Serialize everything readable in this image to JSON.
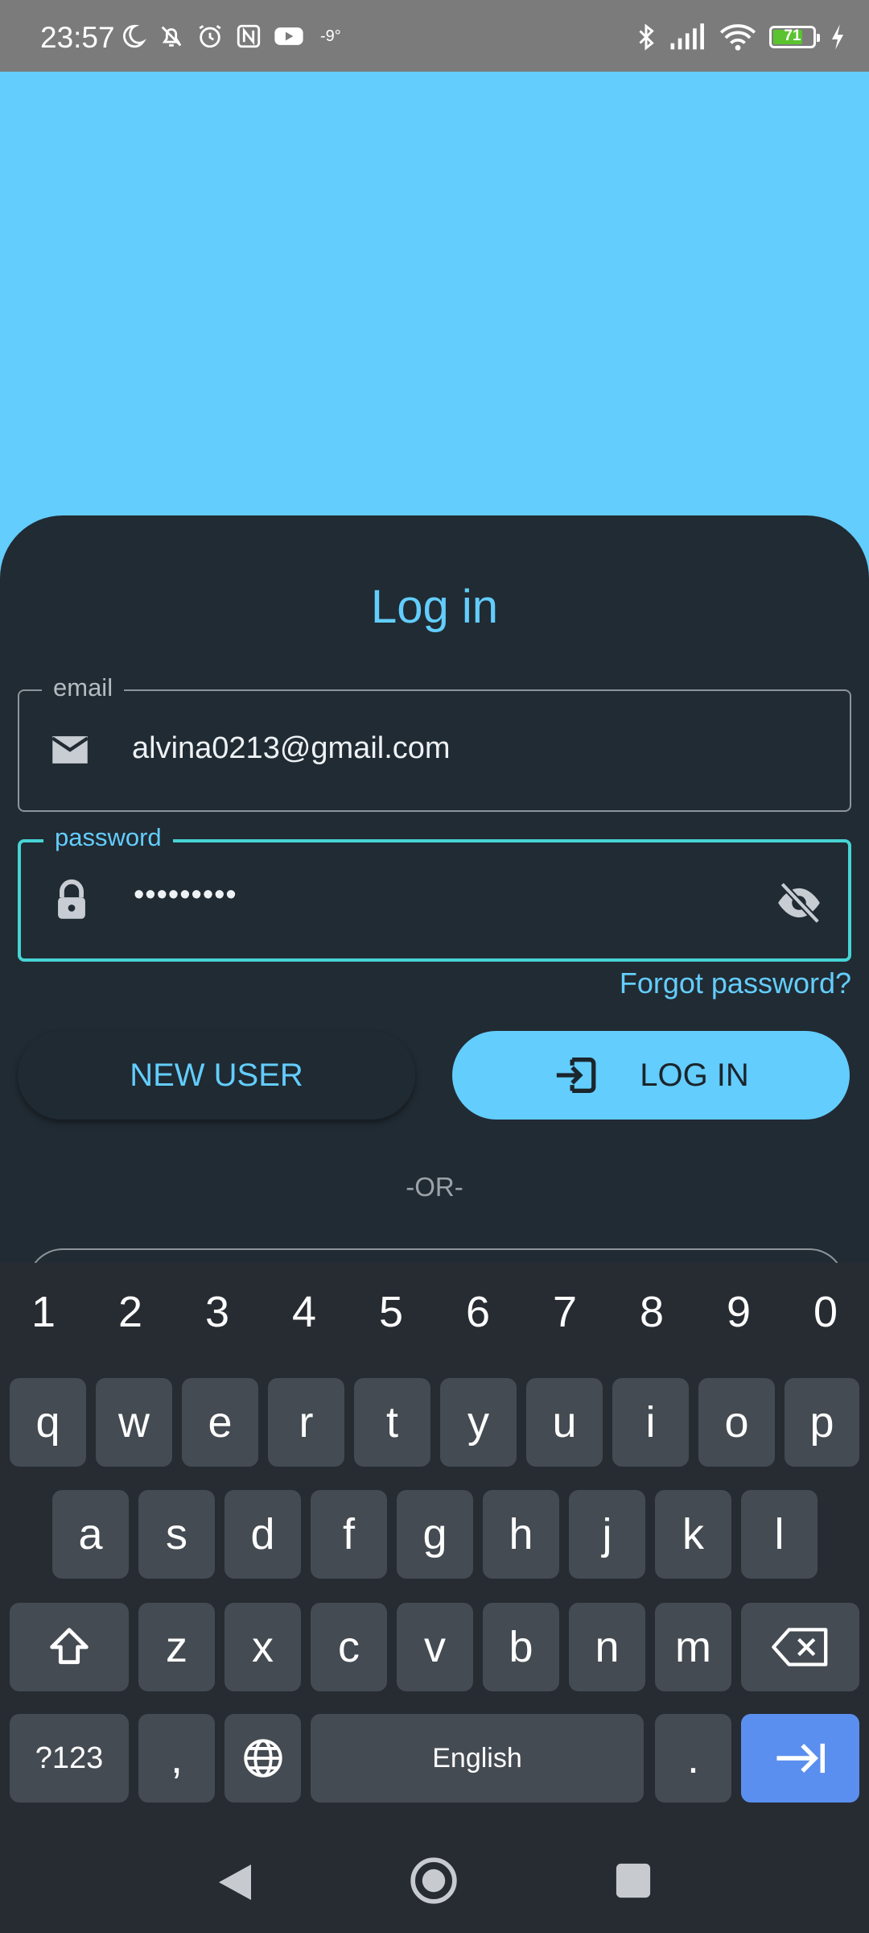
{
  "status_bar": {
    "time": "23:57",
    "temperature": "-9°",
    "battery_level": "71",
    "icons": [
      "moon-icon",
      "bell-off-icon",
      "alarm-icon",
      "nfc-icon",
      "youtube-icon",
      "bluetooth-icon",
      "signal-icon",
      "wifi-icon",
      "battery-icon",
      "charging-icon"
    ]
  },
  "login": {
    "title": "Log in",
    "email_label": "email",
    "email_value": "alvina0213@gmail.com",
    "password_label": "password",
    "password_value": "•••••••••",
    "forgot_password": "Forgot password?",
    "new_user_button": "NEW USER",
    "login_button": "LOG IN",
    "or_divider": "-OR-"
  },
  "keyboard": {
    "number_row": [
      "1",
      "2",
      "3",
      "4",
      "5",
      "6",
      "7",
      "8",
      "9",
      "0"
    ],
    "row1": [
      "q",
      "w",
      "e",
      "r",
      "t",
      "y",
      "u",
      "i",
      "o",
      "p"
    ],
    "row2": [
      "a",
      "s",
      "d",
      "f",
      "g",
      "h",
      "j",
      "k",
      "l"
    ],
    "row3": [
      "z",
      "x",
      "c",
      "v",
      "b",
      "n",
      "m"
    ],
    "symbols_key": "?123",
    "comma_key": ",",
    "space_label": "English",
    "period_key": "."
  },
  "colors": {
    "accent": "#63cdfd",
    "sheet_bg": "#212b33",
    "focus_border": "#46d4d5",
    "enter_key": "#5b8fef"
  }
}
